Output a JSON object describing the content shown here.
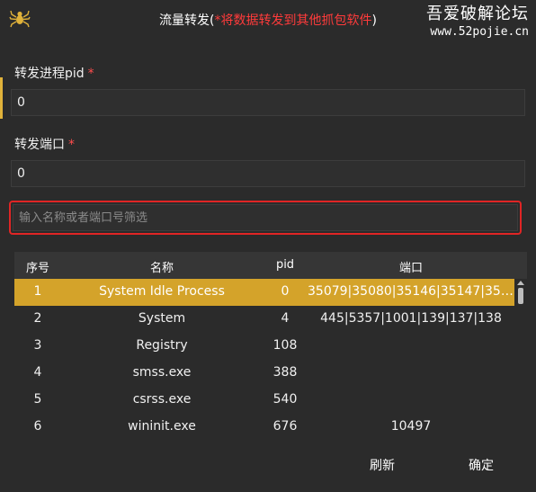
{
  "window": {
    "title_prefix": "流量转发(",
    "title_warning": "*将数据转发到其他抓包软件",
    "title_suffix": ")",
    "logo_icon": "spider-icon"
  },
  "watermark": {
    "name": "吾爱破解论坛",
    "url": "www.52pojie.cn"
  },
  "form": {
    "pid_label": "转发进程pid",
    "pid_required": "*",
    "pid_value": "0",
    "port_label": "转发端口",
    "port_required": "*",
    "port_value": "0",
    "search_placeholder": "输入名称或者端口号筛选"
  },
  "table": {
    "headers": [
      "序号",
      "名称",
      "pid",
      "端口"
    ],
    "rows": [
      {
        "index": "1",
        "name": "System Idle Process",
        "pid": "0",
        "ports": "35079|35080|35146|35147|3515…"
      },
      {
        "index": "2",
        "name": "System",
        "pid": "4",
        "ports": "445|5357|1001|139|137|138"
      },
      {
        "index": "3",
        "name": "Registry",
        "pid": "108",
        "ports": ""
      },
      {
        "index": "4",
        "name": "smss.exe",
        "pid": "388",
        "ports": ""
      },
      {
        "index": "5",
        "name": "csrss.exe",
        "pid": "540",
        "ports": ""
      },
      {
        "index": "6",
        "name": "wininit.exe",
        "pid": "676",
        "ports": "10497"
      }
    ],
    "selected_row": 0
  },
  "footer": {
    "refresh_label": "刷新",
    "confirm_label": "确定"
  },
  "colors": {
    "accent": "#d4a32a",
    "warning": "#ff3b3b",
    "background": "#2b2b2b"
  }
}
